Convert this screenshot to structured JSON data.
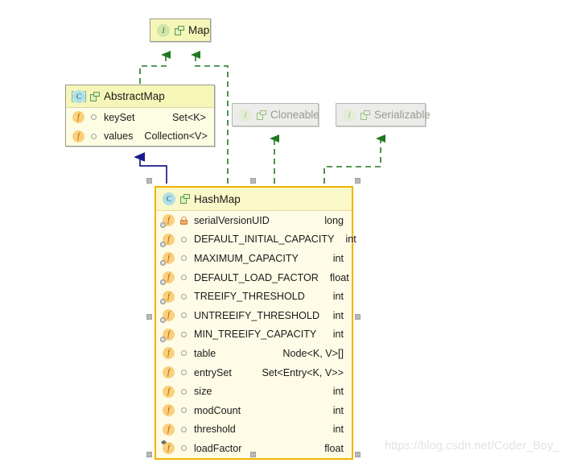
{
  "diagram": {
    "type": "uml-class-diagram",
    "watermark": "https://blog.csdn.net/Coder_Boy_"
  },
  "nodes": {
    "map": {
      "name": "Map",
      "stereotype": "interface",
      "icon": "interface-circle-icon",
      "tag_icon": "type-tag-icon",
      "grayed": false,
      "selected": false,
      "members": []
    },
    "abstract_map": {
      "name": "AbstractMap",
      "stereotype": "abstract-class",
      "icon": "abstract-class-circle-icon",
      "tag_icon": "type-tag-icon",
      "grayed": false,
      "selected": false,
      "members": [
        {
          "name": "keySet",
          "type": "Set<K>",
          "icon": "field-icon",
          "visibility": "package"
        },
        {
          "name": "values",
          "type": "Collection<V>",
          "icon": "field-icon",
          "visibility": "package"
        }
      ]
    },
    "cloneable": {
      "name": "Cloneable",
      "stereotype": "interface",
      "icon": "interface-circle-icon",
      "tag_icon": "type-tag-icon",
      "grayed": true,
      "selected": false,
      "members": []
    },
    "serializable": {
      "name": "Serializable",
      "stereotype": "interface",
      "icon": "interface-circle-icon",
      "tag_icon": "type-tag-icon",
      "grayed": true,
      "selected": false,
      "members": []
    },
    "hash_map": {
      "name": "HashMap",
      "stereotype": "class",
      "icon": "class-circle-icon",
      "tag_icon": "type-tag-icon",
      "grayed": false,
      "selected": true,
      "members": [
        {
          "name": "serialVersionUID",
          "type": "long",
          "icon": "static-field-icon",
          "visibility": "private"
        },
        {
          "name": "DEFAULT_INITIAL_CAPACITY",
          "type": "int",
          "icon": "static-field-icon",
          "visibility": "package"
        },
        {
          "name": "MAXIMUM_CAPACITY",
          "type": "int",
          "icon": "static-field-icon",
          "visibility": "package"
        },
        {
          "name": "DEFAULT_LOAD_FACTOR",
          "type": "float",
          "icon": "static-field-icon",
          "visibility": "package"
        },
        {
          "name": "TREEIFY_THRESHOLD",
          "type": "int",
          "icon": "static-field-icon",
          "visibility": "package"
        },
        {
          "name": "UNTREEIFY_THRESHOLD",
          "type": "int",
          "icon": "static-field-icon",
          "visibility": "package"
        },
        {
          "name": "MIN_TREEIFY_CAPACITY",
          "type": "int",
          "icon": "static-field-icon",
          "visibility": "package"
        },
        {
          "name": "table",
          "type": "Node<K, V>[]",
          "icon": "field-icon",
          "visibility": "package"
        },
        {
          "name": "entrySet",
          "type": "Set<Entry<K, V>>",
          "icon": "field-icon",
          "visibility": "package"
        },
        {
          "name": "size",
          "type": "int",
          "icon": "field-icon",
          "visibility": "package"
        },
        {
          "name": "modCount",
          "type": "int",
          "icon": "field-icon",
          "visibility": "package"
        },
        {
          "name": "threshold",
          "type": "int",
          "icon": "field-icon",
          "visibility": "package"
        },
        {
          "name": "loadFactor",
          "type": "float",
          "icon": "final-field-icon",
          "visibility": "package"
        }
      ]
    }
  },
  "edges": [
    {
      "id": "abstractmap-implements-map",
      "from": "AbstractMap",
      "to": "Map",
      "kind": "realization",
      "style": "dashed",
      "color": "#1f7a1f"
    },
    {
      "id": "hashmap-implements-map",
      "from": "HashMap",
      "to": "Map",
      "kind": "realization",
      "style": "dashed",
      "color": "#1f7a1f"
    },
    {
      "id": "hashmap-implements-cloneable",
      "from": "HashMap",
      "to": "Cloneable",
      "kind": "realization",
      "style": "dashed",
      "color": "#1f7a1f"
    },
    {
      "id": "hashmap-implements-serializable",
      "from": "HashMap",
      "to": "Serializable",
      "kind": "realization",
      "style": "dashed",
      "color": "#1f7a1f"
    },
    {
      "id": "hashmap-extends-abstractmap",
      "from": "HashMap",
      "to": "AbstractMap",
      "kind": "generalization",
      "style": "solid",
      "color": "#1b1b8c"
    }
  ],
  "colors": {
    "node_body": "#fbfbdf",
    "node_header": "#f6f6b8",
    "selection_border": "#f0b400",
    "realization_edge": "#1f7a1f",
    "generalization_edge": "#1b1b8c",
    "grayed_node": "#ececea",
    "watermark": "#e3e3e3"
  }
}
